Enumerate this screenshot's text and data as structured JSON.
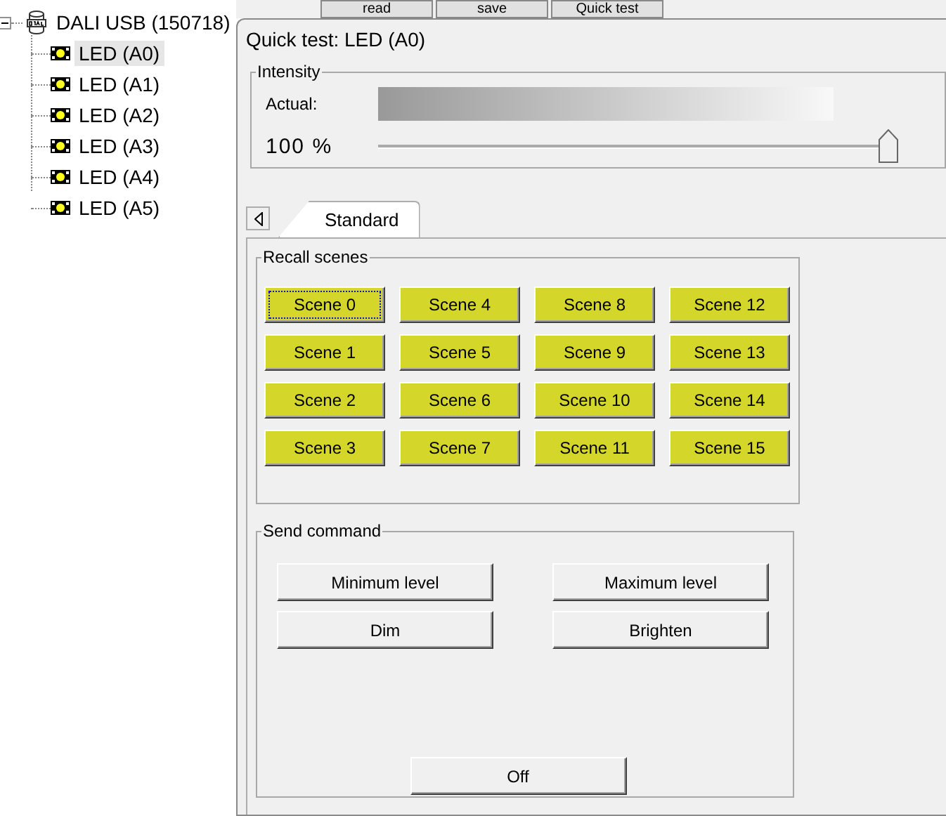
{
  "toolbar": {
    "buttons": [
      "read",
      "save",
      "Quick test"
    ]
  },
  "tree": {
    "label": "DALI USB (150718)",
    "expanded": true,
    "children": [
      {
        "label": "LED (A0)",
        "selected": true
      },
      {
        "label": "LED (A1)",
        "selected": false
      },
      {
        "label": "LED (A2)",
        "selected": false
      },
      {
        "label": "LED (A3)",
        "selected": false
      },
      {
        "label": "LED (A4)",
        "selected": false
      },
      {
        "label": "LED (A5)",
        "selected": false
      }
    ]
  },
  "dialog": {
    "title": "Quick test: LED (A0)",
    "intensity": {
      "title": "Intensity",
      "actual_label": "Actual:",
      "reading": "100 %",
      "level": 1.0
    },
    "tabs": [
      {
        "label": "Standard",
        "selected": true
      }
    ],
    "recall_scenes": {
      "title": "Recall scenes",
      "scenes": [
        {
          "label": "Scene 0",
          "focused": true
        },
        {
          "label": "Scene 4",
          "focused": false
        },
        {
          "label": "Scene 8",
          "focused": false
        },
        {
          "label": "Scene 12",
          "focused": false
        },
        {
          "label": "Scene 1",
          "focused": false
        },
        {
          "label": "Scene 5",
          "focused": false
        },
        {
          "label": "Scene 9",
          "focused": false
        },
        {
          "label": "Scene 13",
          "focused": false
        },
        {
          "label": "Scene 2",
          "focused": false
        },
        {
          "label": "Scene 6",
          "focused": false
        },
        {
          "label": "Scene 10",
          "focused": false
        },
        {
          "label": "Scene 14",
          "focused": false
        },
        {
          "label": "Scene 3",
          "focused": false
        },
        {
          "label": "Scene 7",
          "focused": false
        },
        {
          "label": "Scene 11",
          "focused": false
        },
        {
          "label": "Scene 15",
          "focused": false
        }
      ]
    },
    "send_command": {
      "title": "Send command",
      "buttons": [
        "Minimum level",
        "Maximum level",
        "Dim",
        "Brighten"
      ],
      "off_button": "Off"
    }
  }
}
